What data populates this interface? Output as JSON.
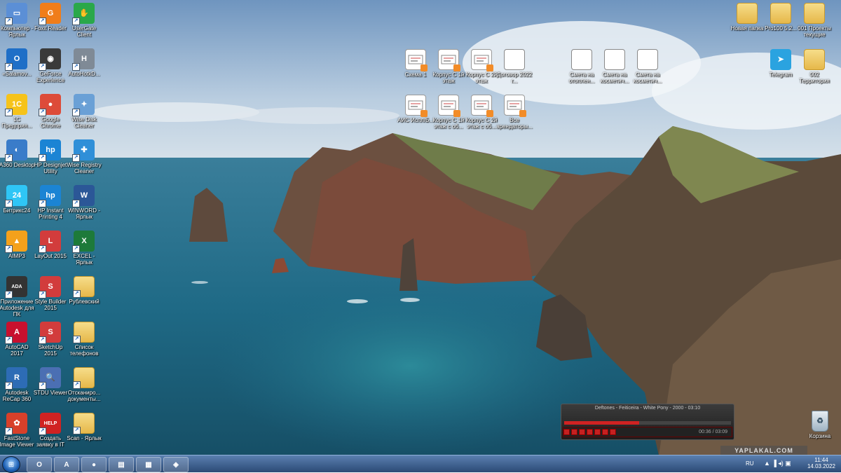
{
  "desktop": {
    "icons_left": [
      {
        "label": "Компьютер - Ярлык",
        "icon": "computer-icon"
      },
      {
        "label": "Foxit Reader",
        "icon": "foxit-pdf-icon"
      },
      {
        "label": "UserGate Client",
        "icon": "usergate-icon"
      },
      {
        "label": "«Salamov...",
        "icon": "outlook-icon"
      },
      {
        "label": "GeForce Experience",
        "icon": "geforce-icon"
      },
      {
        "label": "AutoHotkD...",
        "icon": "autohotkey-icon"
      },
      {
        "label": "1С Предприя...",
        "icon": "1c-icon"
      },
      {
        "label": "Google Chrome",
        "icon": "chrome-icon"
      },
      {
        "label": "Wise Disk Cleaner",
        "icon": "wise-disk-icon"
      },
      {
        "label": "A360 Desktop",
        "icon": "a360-icon"
      },
      {
        "label": "HP Designjet Utility",
        "icon": "hp-icon"
      },
      {
        "label": "Wise Registry Cleaner",
        "icon": "wise-registry-icon"
      },
      {
        "label": "Битрикс24",
        "icon": "bitrix-icon"
      },
      {
        "label": "HP Instant Printing 4",
        "icon": "hp-printing-icon"
      },
      {
        "label": "WINWORD - Ярлык",
        "icon": "word-icon"
      },
      {
        "label": "AIMP3",
        "icon": "aimp-icon"
      },
      {
        "label": "LayOut 2015",
        "icon": "layout-icon"
      },
      {
        "label": "EXCEL - Ярлык",
        "icon": "excel-icon"
      },
      {
        "label": "Приложение Autodesk для ПК",
        "icon": "autodesk-app-icon"
      },
      {
        "label": "Style Builder 2015",
        "icon": "style-builder-icon"
      },
      {
        "label": "Рублевский",
        "icon": "folder-icon"
      },
      {
        "label": "AutoCAD 2017",
        "icon": "autocad-icon"
      },
      {
        "label": "SketchUp 2015",
        "icon": "sketchup-icon"
      },
      {
        "label": "Список телефонов",
        "icon": "folder-icon"
      },
      {
        "label": "Autodesk ReCap 360",
        "icon": "recap-icon"
      },
      {
        "label": "STDU Viewer",
        "icon": "stdu-icon"
      },
      {
        "label": "Отсканиро... документы...",
        "icon": "folder-icon"
      },
      {
        "label": "FastStone Image Viewer",
        "icon": "faststone-icon"
      },
      {
        "label": "Создать заявку в IT",
        "icon": "help-icon"
      },
      {
        "label": "Scan - Ярлык",
        "icon": "folder-icon"
      }
    ],
    "icons_middle": [
      {
        "label": "Схема 1",
        "icon": "dwg-icon"
      },
      {
        "label": "Корпус С 1й этаж",
        "icon": "dwg-icon"
      },
      {
        "label": "Корпус С 2й этаж",
        "icon": "dwg-icon"
      },
      {
        "label": "Договор 2022 г...",
        "icon": "word-doc-icon"
      },
      {
        "label": "АИС Испл/Б...",
        "icon": "dwg-icon"
      },
      {
        "label": "Корпус С 1й этаж с об...",
        "icon": "dwg-icon"
      },
      {
        "label": "Корпус С 2й этаж с об...",
        "icon": "dwg-icon"
      },
      {
        "label": "Все арендаторы...",
        "icon": "dwg-icon"
      }
    ],
    "icons_xls": [
      {
        "label": "Смета на отоплен...",
        "icon": "excel-doc-icon"
      },
      {
        "label": "Смета на косметич...",
        "icon": "excel-doc-icon"
      },
      {
        "label": "Смета на косметич...",
        "icon": "excel-doc-icon"
      }
    ],
    "icons_right": [
      {
        "label": "Новая папка",
        "icon": "folder-icon"
      },
      {
        "label": "Pro100 5.2...",
        "icon": "folder-icon"
      },
      {
        "label": "001 Проекты текущие",
        "icon": "folder-icon"
      },
      {
        "label": "Telegram",
        "icon": "telegram-icon"
      },
      {
        "label": "002 Территория",
        "icon": "folder-icon"
      }
    ],
    "recycle_bin": {
      "label": "Корзина"
    }
  },
  "player": {
    "track_title": "Deftones - Feiticeira - White Pony - 2000 - 03:10",
    "time_display": "00:36 / 03:09",
    "progress": 0.45
  },
  "taskbar": {
    "pinned": [
      {
        "name": "outlook",
        "glyph": "O"
      },
      {
        "name": "autocad",
        "glyph": "A"
      },
      {
        "name": "chrome",
        "glyph": "●"
      },
      {
        "name": "explorer",
        "glyph": "▤"
      },
      {
        "name": "calculator",
        "glyph": "▦"
      },
      {
        "name": "app",
        "glyph": "◈"
      }
    ],
    "language": "RU",
    "time": "11:44",
    "date": "14.03.2022"
  },
  "watermark": "YAPLAKAL.COM",
  "colors": {
    "sea": "#1f6a86",
    "sky": "#9fbdd6",
    "cliff": "#5b4a3a",
    "taskbar": "#2c4a75",
    "accent": "#d02222"
  }
}
